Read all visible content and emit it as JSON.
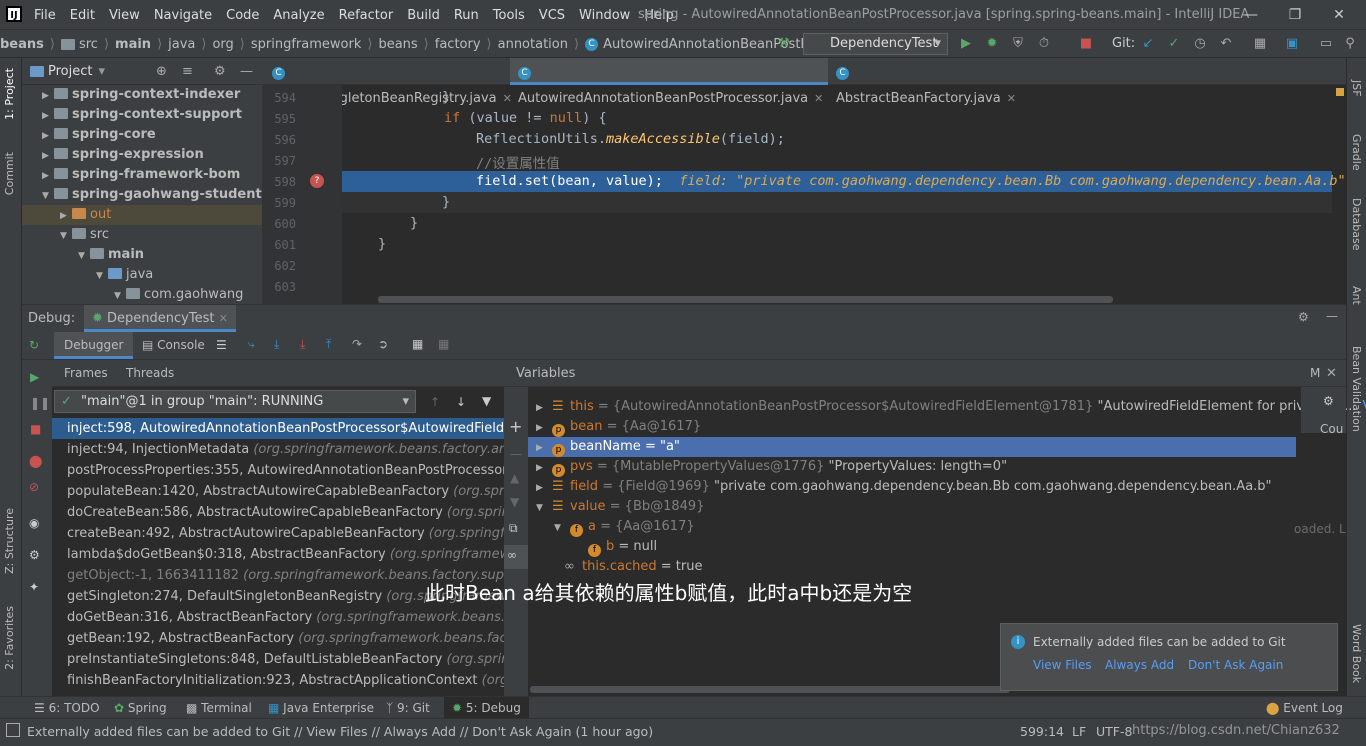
{
  "app": {
    "menu": [
      "File",
      "Edit",
      "View",
      "Navigate",
      "Code",
      "Analyze",
      "Refactor",
      "Build",
      "Run",
      "Tools",
      "VCS",
      "Window",
      "Help"
    ],
    "window_title": "spring - AutowiredAnnotationBeanPostProcessor.java [spring.spring-beans.main] - IntelliJ IDEA"
  },
  "breadcrumb": [
    "beans",
    "src",
    "main",
    "java",
    "org",
    "springframework",
    "beans",
    "factory",
    "annotation",
    "AutowiredAnnotationBeanPostProcessor"
  ],
  "run_config": "DependencyTest",
  "git_label": "Git:",
  "project": {
    "title": "Project",
    "items": [
      {
        "label": "spring-context-indexer"
      },
      {
        "label": "spring-context-support"
      },
      {
        "label": "spring-core"
      },
      {
        "label": "spring-expression"
      },
      {
        "label": "spring-framework-bom"
      },
      {
        "label": "spring-gaohwang-student"
      },
      {
        "label": "out"
      },
      {
        "label": "src"
      },
      {
        "label": "main"
      },
      {
        "label": "java"
      },
      {
        "label": "com.gaohwang"
      }
    ]
  },
  "editor": {
    "tabs": [
      {
        "label": "DefaultSingletonBeanRegistry.java"
      },
      {
        "label": "AutowiredAnnotationBeanPostProcessor.java"
      },
      {
        "label": "AbstractBeanFactory.java"
      }
    ],
    "line_numbers": [
      "594",
      "595",
      "596",
      "597",
      "598",
      "599",
      "600",
      "601",
      "602",
      "603"
    ],
    "code": {
      "l594": "}",
      "l595_kw1": "if",
      "l595_rest": " (value != ",
      "l595_kw2": "null",
      "l595_end": ") {",
      "l596_a": "ReflectionUtils.",
      "l596_fn": "makeAccessible",
      "l596_b": "(field);",
      "l597": "//设置属性值",
      "l598_a": "field.set(bean, value);",
      "l598_hint": "field: \"private com.gaohwang.dependency.bean.Bb com.gaohwang.dependency.bean.Aa.b\"",
      "l599": "}",
      "l600": "}",
      "l601": "}"
    }
  },
  "debug": {
    "label": "Debug:",
    "session": "DependencyTest",
    "tab_debugger": "Debugger",
    "tab_console": "Console",
    "frames_tab": "Frames",
    "threads_tab": "Threads",
    "thread_select": "\"main\"@1 in group \"main\": RUNNING",
    "variables_title": "Variables",
    "frames": [
      {
        "m": "inject:598, AutowiredAnnotationBeanPostProcessor$AutowiredFieldElement",
        "p": ""
      },
      {
        "m": "inject:94, InjectionMetadata",
        "p": "(org.springframework.beans.factory.annotatio"
      },
      {
        "m": "postProcessProperties:355, AutowiredAnnotationBeanPostProcessor",
        "p": "(org.s"
      },
      {
        "m": "populateBean:1420, AbstractAutowireCapableBeanFactory",
        "p": "(org.springfram"
      },
      {
        "m": "doCreateBean:586, AbstractAutowireCapableBeanFactory",
        "p": "(org.springframe"
      },
      {
        "m": "createBean:492, AbstractAutowireCapableBeanFactory",
        "p": "(org.springframewo"
      },
      {
        "m": "lambda$doGetBean$0:318, AbstractBeanFactory",
        "p": "(org.springframework.bea"
      },
      {
        "m": "getObject:-1, 1663411182",
        "p": "(org.springframework.beans.factory.support.Abs"
      },
      {
        "m": "getSingleton:274, DefaultSingletonBeanRegistry",
        "p": "(org.springframework.be"
      },
      {
        "m": "doGetBean:316, AbstractBeanFactory",
        "p": "(org.springframework.beans.factory.s"
      },
      {
        "m": "getBean:192, AbstractBeanFactory",
        "p": "(org.springframework.beans.factory.sup"
      },
      {
        "m": "preInstantiateSingletons:848, DefaultListableBeanFactory",
        "p": "(org.springframew"
      },
      {
        "m": "finishBeanFactoryInitialization:923, AbstractApplicationContext",
        "p": "(org.springfr"
      }
    ],
    "variables": [
      {
        "name": "this",
        "type": " = {AutowiredAnnotationBeanPostProcessor$AutowiredFieldElement@1781}",
        "val": " \"AutowiredFieldElement for private co...",
        "link": "View"
      },
      {
        "name": "bean",
        "type": " = {Aa@1617}",
        "val": ""
      },
      {
        "name": "beanName",
        "type": " = \"a\"",
        "val": ""
      },
      {
        "name": "pvs",
        "type": " = {MutablePropertyValues@1776}",
        "val": " \"PropertyValues: length=0\""
      },
      {
        "name": "field",
        "type": " = {Field@1969}",
        "val": " \"private com.gaohwang.dependency.bean.Bb com.gaohwang.dependency.bean.Aa.b\""
      },
      {
        "name": "value",
        "type": " = {Bb@1849}",
        "val": ""
      },
      {
        "name": "a",
        "type": " = {Aa@1617}",
        "val": ""
      },
      {
        "name": "b",
        "type": " = null",
        "val": ""
      },
      {
        "name": "this.cached",
        "type": " = true",
        "val": ""
      }
    ],
    "right_fragments": {
      "m": "M",
      "cou": "Cou",
      "loaded": "oaded. L"
    }
  },
  "caption": "此时Bean a给其依赖的属性b赋值，此时a中b还是为空",
  "notification": {
    "text": "Externally added files can be added to Git",
    "actions": [
      "View Files",
      "Always Add",
      "Don't Ask Again"
    ]
  },
  "left_strip": [
    "1: Project",
    "Commit",
    "Z: Structure",
    "2: Favorites"
  ],
  "right_strip": [
    "JSF",
    "Gradle",
    "Database",
    "Ant",
    "Bean Validation",
    "Word Book"
  ],
  "tool_windows": [
    {
      "label": "6: TODO"
    },
    {
      "label": "Spring"
    },
    {
      "label": "Terminal"
    },
    {
      "label": "Java Enterprise"
    },
    {
      "label": "9: Git"
    },
    {
      "label": "5: Debug"
    }
  ],
  "event_log": "Event Log",
  "status": {
    "message": "Externally added files can be added to Git // View Files // Always Add // Don't Ask Again (1 hour ago)",
    "position": "599:14",
    "line_sep": "LF",
    "encoding": "UTF-8",
    "watermark": "https://blog.csdn.net/Chianz632"
  }
}
